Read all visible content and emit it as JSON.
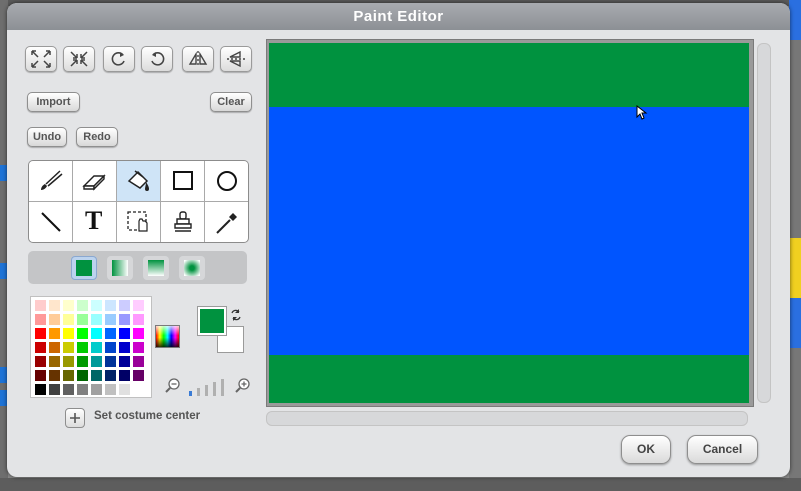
{
  "dialog": {
    "title": "Paint Editor"
  },
  "toolbar": {
    "transform_buttons": [
      {
        "name": "grow-icon"
      },
      {
        "name": "shrink-icon"
      },
      {
        "name": "rotate-right-icon"
      },
      {
        "name": "rotate-left-icon"
      },
      {
        "name": "flip-horizontal-icon"
      },
      {
        "name": "flip-vertical-icon"
      }
    ],
    "import_label": "Import",
    "clear_label": "Clear",
    "undo_label": "Undo",
    "redo_label": "Redo"
  },
  "tools": {
    "selected": "paint-bucket",
    "items": [
      "paintbrush-icon",
      "eraser-icon",
      "paint-bucket-icon",
      "rectangle-icon",
      "ellipse-icon",
      "line-icon",
      "text-icon",
      "select-icon",
      "stamp-icon",
      "eyedropper-icon"
    ],
    "text_tool_label": "T"
  },
  "fill_options": {
    "selected": "solid",
    "items": [
      "solid",
      "horizontal-gradient",
      "vertical-gradient",
      "radial-gradient"
    ]
  },
  "colors": {
    "foreground": "#00923f",
    "background": "#ffffff",
    "palette": [
      [
        "#ffcccc",
        "#ffe6cc",
        "#ffffcc",
        "#ccffcc",
        "#ccffff",
        "#cce6ff",
        "#ccccff",
        "#ffccff"
      ],
      [
        "#ff9999",
        "#ffcc99",
        "#ffff99",
        "#99ff99",
        "#99ffff",
        "#99ccff",
        "#9999ff",
        "#ff99ff"
      ],
      [
        "#ff0000",
        "#ff9900",
        "#ffff00",
        "#00ff00",
        "#00ffff",
        "#0066ff",
        "#0000ff",
        "#ff00ff"
      ],
      [
        "#cc0000",
        "#cc6600",
        "#cccc00",
        "#00cc00",
        "#00cccc",
        "#0044cc",
        "#0000cc",
        "#cc00cc"
      ],
      [
        "#990000",
        "#996600",
        "#999900",
        "#009900",
        "#009999",
        "#003399",
        "#000099",
        "#990099"
      ],
      [
        "#660000",
        "#663300",
        "#666600",
        "#006600",
        "#006666",
        "#002266",
        "#000066",
        "#660066"
      ],
      [
        "#000000",
        "#404040",
        "#606060",
        "#808080",
        "#a0a0a0",
        "#c0c0c0",
        "#e0e0e0",
        "#ffffff"
      ]
    ]
  },
  "canvas": {
    "background": "#0055ff",
    "band_color": "#00923f"
  },
  "costume_center": {
    "label": "Set costume center"
  },
  "buttons": {
    "ok": "OK",
    "cancel": "Cancel"
  }
}
